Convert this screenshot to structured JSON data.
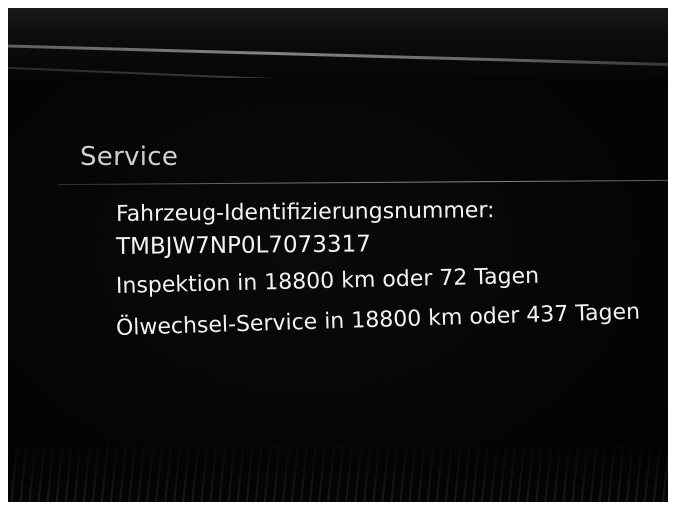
{
  "screen": {
    "title": "Service",
    "vin_label": "Fahrzeug-Identifizierungsnummer:",
    "vin_value": "TMBJW7NP0L7073317",
    "inspection": "Inspektion in 18800 km oder 72 Tagen",
    "oil_service": "Ölwechsel-Service in 18800 km oder 437 Tagen"
  }
}
